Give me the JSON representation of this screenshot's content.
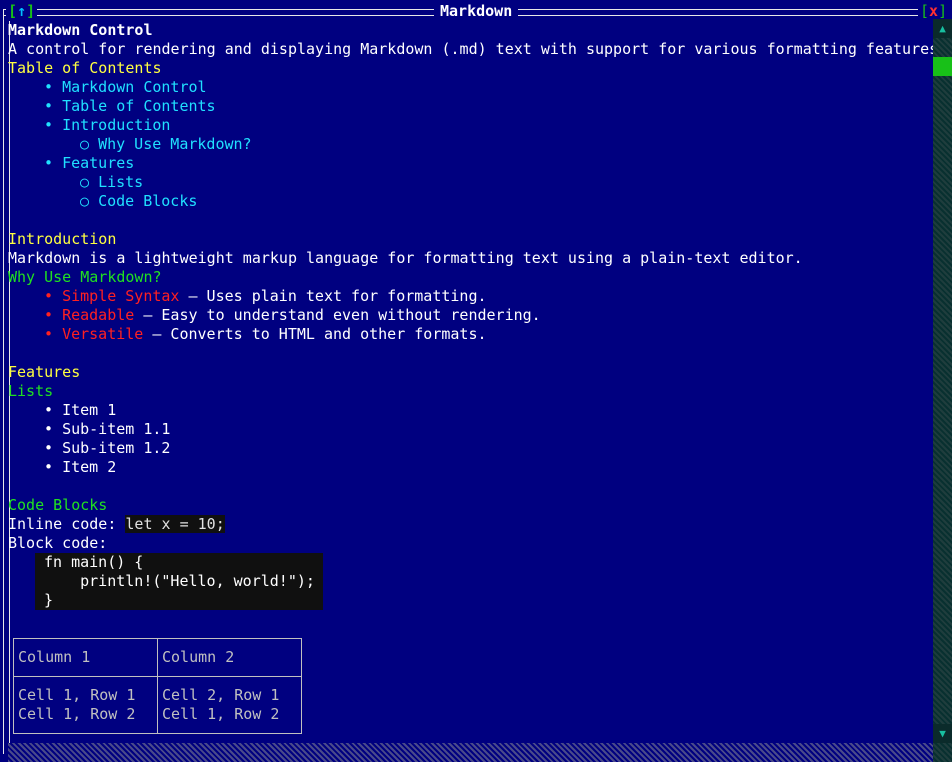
{
  "window": {
    "title": "Markdown",
    "up_icon": "↑",
    "close_icon": "x"
  },
  "doc": {
    "h1": "Markdown Control",
    "intro": "A control for rendering and displaying Markdown (.md) text with support for various formatting features.",
    "toc_heading": "Table of Contents",
    "toc": [
      {
        "label": "Markdown Control"
      },
      {
        "label": "Table of Contents"
      },
      {
        "label": "Introduction"
      },
      {
        "label": "Why Use Markdown?"
      },
      {
        "label": "Features"
      },
      {
        "label": "Lists"
      },
      {
        "label": "Code Blocks"
      }
    ],
    "intro_heading": "Introduction",
    "intro_text": "Markdown is a lightweight markup language for formatting text using a plain-text editor.",
    "why_heading": "Why Use Markdown?",
    "why_items": [
      {
        "term": "Simple Syntax",
        "desc": " – Uses plain text for formatting."
      },
      {
        "term": "Readable",
        "desc": " – Easy to understand even without rendering."
      },
      {
        "term": "Versatile",
        "desc": " – Converts to HTML and other formats."
      }
    ],
    "features_heading": "Features",
    "lists_heading": "Lists",
    "list_items": [
      "Item 1",
      "Sub-item 1.1",
      "Sub-item 1.2",
      "Item 2"
    ],
    "code_heading": "Code Blocks",
    "inline_label": "Inline code: ",
    "inline_code": "let x = 10;",
    "block_label": "Block code:",
    "code_lines": [
      "fn main() {",
      "    println!(\"Hello, world!\");",
      "}"
    ],
    "table": {
      "headers": [
        "Column 1",
        "Column 2"
      ],
      "rows": [
        [
          "Cell 1, Row 1",
          "Cell 2, Row 1"
        ],
        [
          "Cell 1, Row 2",
          "Cell 1, Row 2"
        ]
      ]
    }
  },
  "bullet_char": "•",
  "sub_bullet_char": "○",
  "colors": {
    "background": "#000080",
    "heading_h2": "#ffff40",
    "heading_h3": "#20e020",
    "link": "#20e0ff",
    "bold_term": "#ff2020",
    "code_bg": "#101010"
  }
}
